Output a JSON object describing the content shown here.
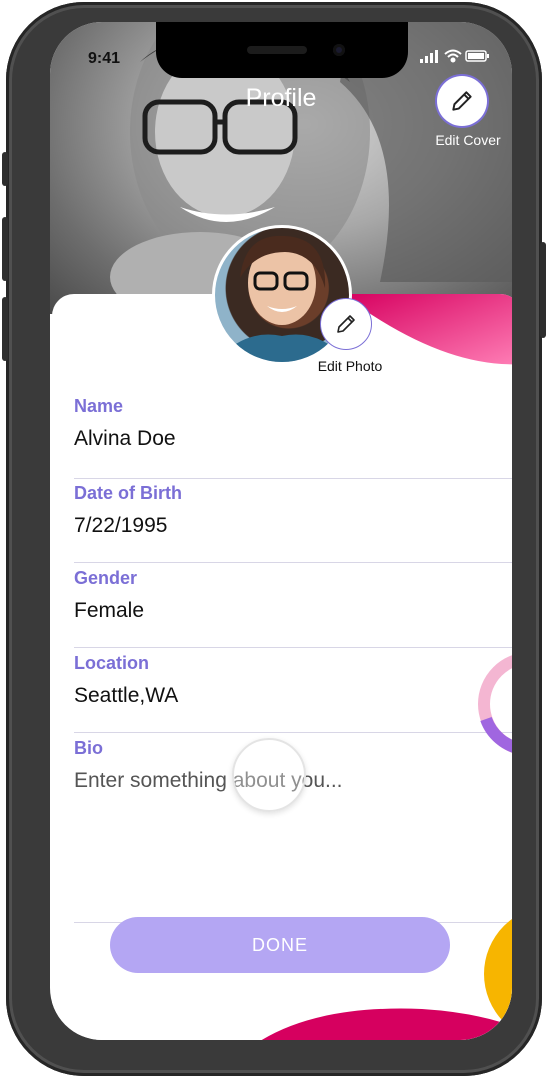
{
  "status_bar": {
    "time": "9:41"
  },
  "header": {
    "title": "Profile",
    "edit_cover_label": "Edit Cover"
  },
  "avatar": {
    "edit_photo_label": "Edit Photo"
  },
  "fields": {
    "name": {
      "label": "Name",
      "value": "Alvina Doe"
    },
    "dob": {
      "label": "Date of Birth",
      "value": "7/22/1995"
    },
    "gender": {
      "label": "Gender",
      "value": "Female"
    },
    "location": {
      "label": "Location",
      "value": "Seattle,WA"
    },
    "bio": {
      "label": "Bio",
      "placeholder": "Enter something about you..."
    }
  },
  "actions": {
    "done_label": "DONE"
  },
  "colors": {
    "accent": "#7b6fd6",
    "button": "#b4a6f3",
    "magenta": "#d6005f",
    "amber": "#f7b500"
  },
  "icons": [
    "pencil-icon",
    "signal-icon",
    "wifi-icon",
    "battery-icon"
  ]
}
